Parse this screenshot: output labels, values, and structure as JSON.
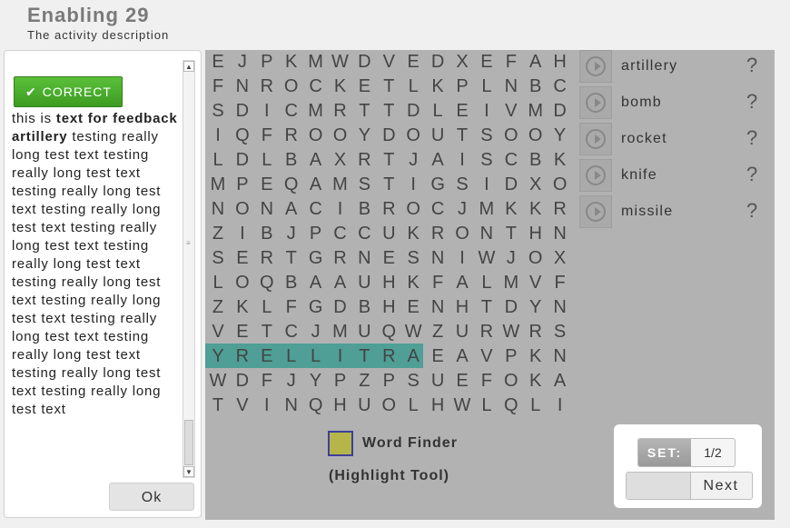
{
  "page": {
    "title": "Enabling 29",
    "subtitle": "The activity description"
  },
  "feedback": {
    "status_label": "CORRECT",
    "status_icon": "checkmark-icon",
    "status_color": "#4cae2e",
    "text_plain_prefix": "this is ",
    "text_bold": "text for feedback artillery",
    "text_body": " testing really long test text testing really long test text testing really long test text testing really long test text testing really long test text testing really long test text testing really long test text testing really long test text testing really long test text testing really long test text testing really long test text testing really long test text",
    "ok_label": "Ok"
  },
  "grid": {
    "rows": [
      "EJPKMWDVEDXEFAH",
      "FNROCKETLKPLNBC",
      "SDICMRTTDLEIVMD",
      "IQFROOYDOUTSOOY",
      "LDLBAXRTJAISCBK",
      "MPEQAMSTIGSIDXO",
      "NONACIBROCJMKKR",
      "ZIBJPCCUKRONTHN",
      "SERTGRNESNIWJOX",
      "LOQBAAUHKFALMVF",
      "ZKLFGDBHENHTDYN",
      "VETCJMUQWZURWRS",
      "YRELLITRAEAVPKN",
      "WDFJYPZPSUEFOKA",
      "TVINQHUOLHWLQLI"
    ],
    "highlight_color": "#4f9f96"
  },
  "words": [
    {
      "label": "artillery",
      "help": "?"
    },
    {
      "label": "bomb",
      "help": "?"
    },
    {
      "label": "rocket",
      "help": "?"
    },
    {
      "label": "knife",
      "help": "?"
    },
    {
      "label": "missile",
      "help": "?"
    }
  ],
  "tool": {
    "name": "Word Finder",
    "sub": "(Highlight Tool)",
    "swatch_color": "#b5b54a"
  },
  "nav": {
    "set_label": "SET:",
    "set_value": "1/2",
    "next_label": "Next"
  }
}
